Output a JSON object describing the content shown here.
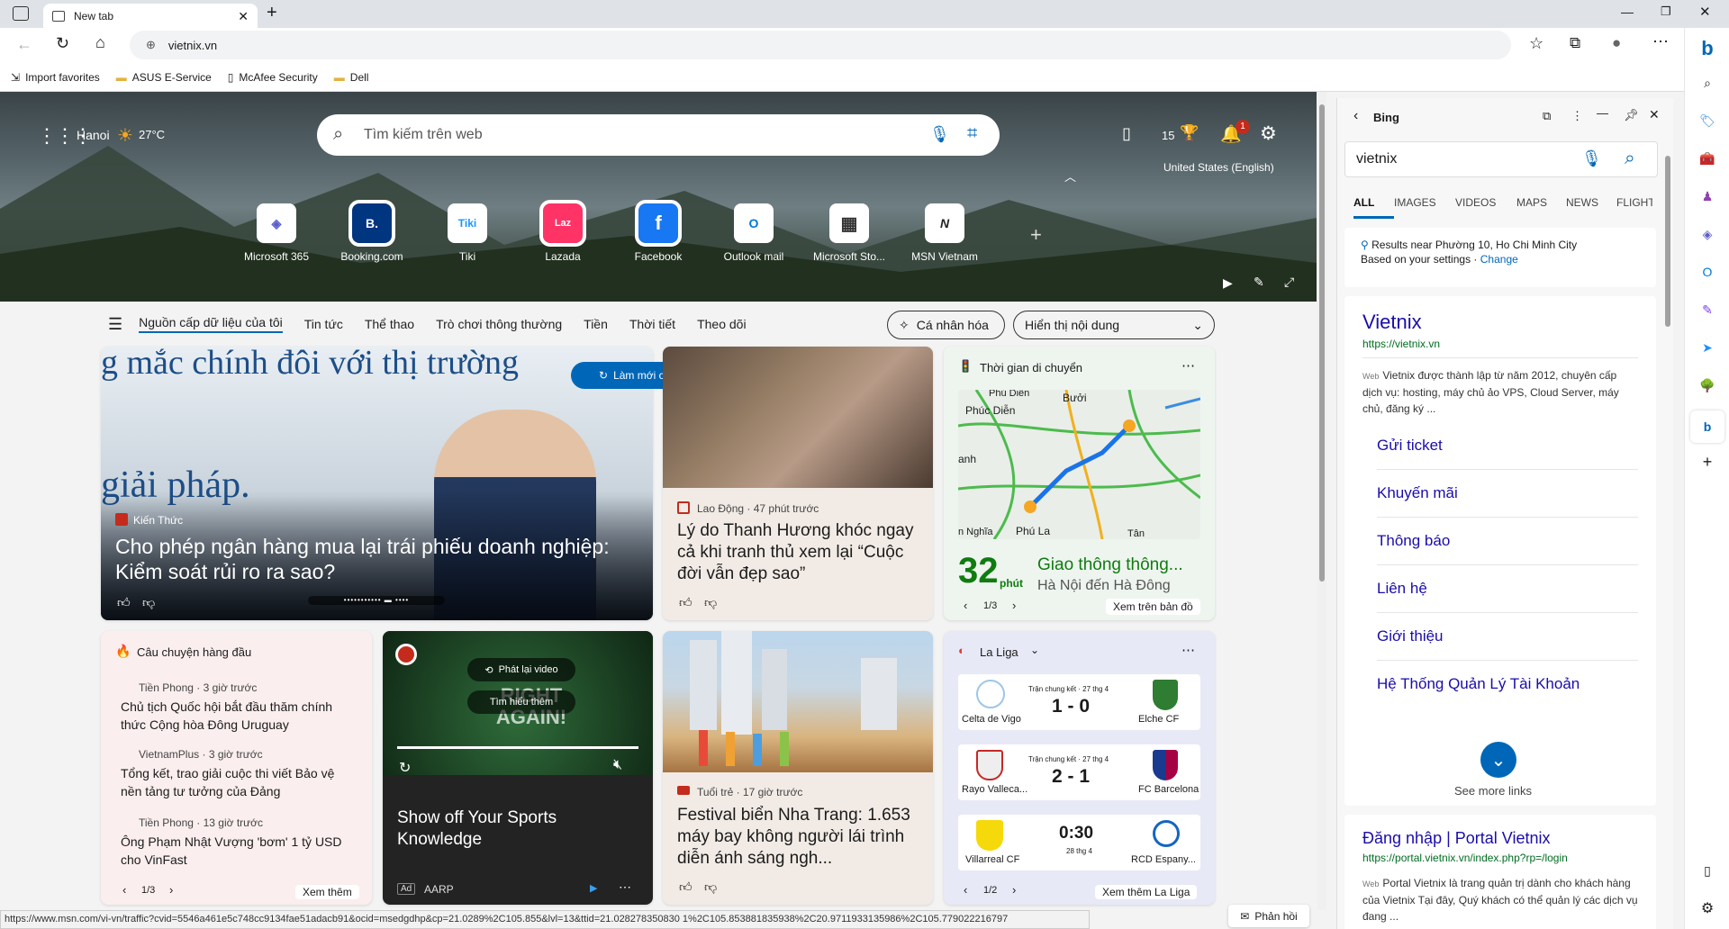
{
  "browser": {
    "tab_title": "New tab",
    "url": "vietnix.vn"
  },
  "favorites": [
    {
      "label": "Import favorites",
      "icon": "import-icon"
    },
    {
      "label": "ASUS E-Service",
      "icon": "folder-icon"
    },
    {
      "label": "McAfee Security",
      "icon": "page-icon"
    },
    {
      "label": "Dell",
      "icon": "folder-icon"
    }
  ],
  "hero": {
    "city": "Hanoi",
    "temp": "27°C",
    "search_placeholder": "Tìm kiếm trên web",
    "points": "15",
    "notif_count": "1",
    "locale": "United States (English)"
  },
  "tiles": [
    {
      "label": "Microsoft 365",
      "glyph": "◈"
    },
    {
      "label": "Booking.com",
      "glyph": "B."
    },
    {
      "label": "Tiki",
      "glyph": "Tiki"
    },
    {
      "label": "Lazada",
      "glyph": "Laz"
    },
    {
      "label": "Facebook",
      "glyph": "f"
    },
    {
      "label": "Outlook mail",
      "glyph": "O"
    },
    {
      "label": "Microsoft Sto...",
      "glyph": "▦"
    },
    {
      "label": "MSN Vietnam",
      "glyph": "N"
    }
  ],
  "nav": {
    "items": [
      "Nguồn cấp dữ liệu của tôi",
      "Tin tức",
      "Thể thao",
      "Trò chơi thông thường",
      "Tiền",
      "Thời tiết",
      "Theo dõi"
    ],
    "personalize": "Cá nhân hóa",
    "display": "Hiển thị nội dung"
  },
  "feed": {
    "refresh": "Làm mới câu chuyện",
    "main": {
      "source": "Kiến Thức",
      "title": "Cho phép ngân hàng mua lại trái phiếu doanh nghiệp: Kiểm soát rủi ro ra sao?",
      "bg_text_1": "g mắc chính đôi với thị trường",
      "bg_text_2": "giải pháp."
    },
    "story2": {
      "source": "Lao Động · 47 phút trước",
      "title": "Lý do Thanh Hương khóc ngay cả khi tranh thủ xem lại “Cuộc đời vẫn đẹp sao”"
    },
    "traffic": {
      "header": "Thời gian di chuyển",
      "minutes": "32",
      "unit": "phút",
      "title": "Giao thông thông...",
      "subtitle": "Hà Nội đến Hà Đông",
      "pager": "1/3",
      "link": "Xem trên bản đồ",
      "map_labels": [
        "Phú Diễn",
        "Bưởi",
        "Phúc Diễn",
        "anh",
        "Phú La",
        "n Nghĩa",
        "Tân"
      ]
    },
    "top": {
      "header": "Câu chuyện hàng đầu",
      "items": [
        {
          "source": "Tiền Phong · 3 giờ trước",
          "title": "Chủ tịch Quốc hội bắt đầu thăm chính thức Cộng hòa Đông Uruguay"
        },
        {
          "source": "VietnamPlus · 3 giờ trước",
          "title": "Tổng kết, trao giải cuộc thi viết Bảo vệ nền tảng tư tưởng của Đảng"
        },
        {
          "source": "Tiền Phong · 13 giờ trước",
          "title": "Ông Phạm Nhật Vượng 'bơm' 1 tỷ USD cho VinFast"
        }
      ],
      "pager": "1/3",
      "link": "Xem thêm"
    },
    "ad": {
      "replay": "Phát lại video",
      "learn": "Tìm hiểu thêm",
      "title": "Show off Your Sports Knowledge",
      "badge": "Ad",
      "brand": "AARP",
      "bg_text": "RIGHT AGAIN!"
    },
    "story3": {
      "source": "Tuổi trẻ · 17 giờ trước",
      "title": "Festival biển Nha Trang: 1.653 máy bay không người lái trình diễn ánh sáng ngh..."
    },
    "laliga": {
      "header": "La Liga",
      "matches": [
        {
          "home": "Celta de Vigo",
          "away": "Elche CF",
          "status": "Trận chung kết · 27 thg 4",
          "score": "1 - 0"
        },
        {
          "home": "Rayo Valleca...",
          "away": "FC Barcelona",
          "status": "Trận chung kết · 27 thg 4",
          "score": "2 - 1"
        },
        {
          "home": "Villarreal CF",
          "away": "RCD Espany...",
          "status": "28 thg 4",
          "score": "0:30"
        }
      ],
      "pager": "1/2",
      "link": "Xem thêm La Liga"
    },
    "feedback": "Phản hồi"
  },
  "bing": {
    "title": "Bing",
    "query": "vietnix",
    "tabs": [
      "ALL",
      "IMAGES",
      "VIDEOS",
      "MAPS",
      "NEWS",
      "FLIGHT"
    ],
    "location": "Results near Phường 10, Ho Chi Minh City",
    "location_sub": "Based on your settings ·",
    "change": "Change",
    "result1": {
      "title": "Vietnix",
      "url": "https://vietnix.vn",
      "web": "Web",
      "snippet": "Vietnix được thành lập từ năm 2012, chuyên cấp dịch vụ: hosting, máy chủ ảo VPS, Cloud Server, máy chủ, đăng ký ..."
    },
    "links": [
      "Gửi ticket",
      "Khuyến mãi",
      "Thông báo",
      "Liên hệ",
      "Giới thiệu",
      "Hệ Thống Quản Lý Tài Khoản"
    ],
    "see_more": "See more links",
    "result2": {
      "title": "Đăng nhập | Portal Vietnix",
      "url": "https://portal.vietnix.vn/index.php?rp=/login",
      "web": "Web",
      "snippet": "Portal Vietnix là trang quản trị dành cho khách hàng của Vietnix Tại đây, Quý khách có thể quản lý các dịch vụ đang ..."
    }
  },
  "status_url": "https://www.msn.com/vi-vn/traffic?cvid=5546a461e5c748cc9134fae51adacb91&ocid=msedgdhp&cp=21.0289%2C105.855&lvl=13&ttid=21.028278350830 1%2C105.853881835938%2C20.9711933135986%2C105.779022216797",
  "colors": {
    "accent": "#0067b8",
    "traffic_green": "#107c10",
    "bing_link": "#1a0dab"
  }
}
